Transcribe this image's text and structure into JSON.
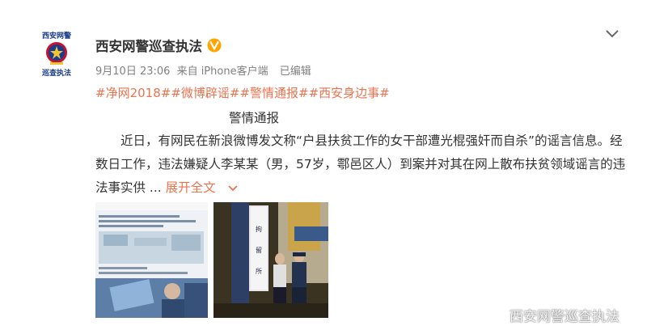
{
  "post": {
    "username": "西安网警巡查执法",
    "avatar_text_top": "西安网警",
    "avatar_text_bottom": "巡查执法",
    "timestamp": "9月10日 23:06",
    "source": "来自 iPhone客户端",
    "edited": "已编辑",
    "hashtags": [
      "#净网2018#",
      "#微博辟谣#",
      "#警情通报#",
      "#西安身边事#"
    ],
    "heading": "警情通报",
    "body": "　　近日，有网民在新浪微博发文称“户县扶贫工作的女干部遭光棍强奸而自杀”的谣言信息。经数日工作，违法嫌疑人李某某（男，57岁，鄠邑区人）到案并对其在网上散布扶贫领域谣言的违法事实供 ...",
    "expand_label": "展开全文",
    "images": [
      {
        "name": "screenshot-thumbnail"
      },
      {
        "name": "police-station-photo",
        "sign_text": "拘留所"
      }
    ],
    "watermark": "西安网警巡查执法"
  },
  "colors": {
    "accent": "#eb7350",
    "verified": "#ffa500",
    "meta": "#808080"
  },
  "icons": {
    "verified": "verified-badge-icon",
    "menu": "chevron-down-icon",
    "expand": "chevron-down-icon",
    "weibo_logo": "weibo-logo-icon"
  }
}
